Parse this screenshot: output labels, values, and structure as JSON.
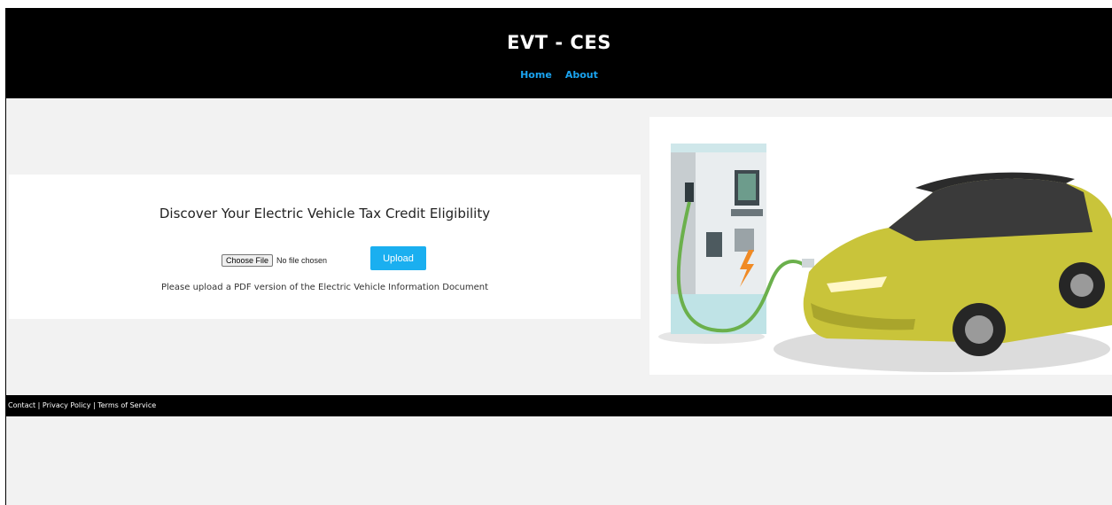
{
  "header": {
    "title": "EVT - CES",
    "nav": [
      {
        "label": "Home"
      },
      {
        "label": "About"
      }
    ]
  },
  "main": {
    "heading": "Discover Your Electric Vehicle Tax Credit Eligibility",
    "file_input": {
      "button_label": "Choose File",
      "status": "No file chosen"
    },
    "upload_label": "Upload",
    "hint": "Please upload a PDF version of the Electric Vehicle Information Document"
  },
  "illustration": {
    "subject": "electric car charging at charging station"
  },
  "footer": {
    "links": [
      "Contact",
      "Privacy Policy",
      "Terms of Service"
    ],
    "separator": " | "
  },
  "colors": {
    "header_bg": "#000000",
    "nav_link": "#1aa3ef",
    "upload_button": "#1aaff0",
    "page_bg": "#f2f2f2",
    "car_body": "#c9c43a"
  }
}
